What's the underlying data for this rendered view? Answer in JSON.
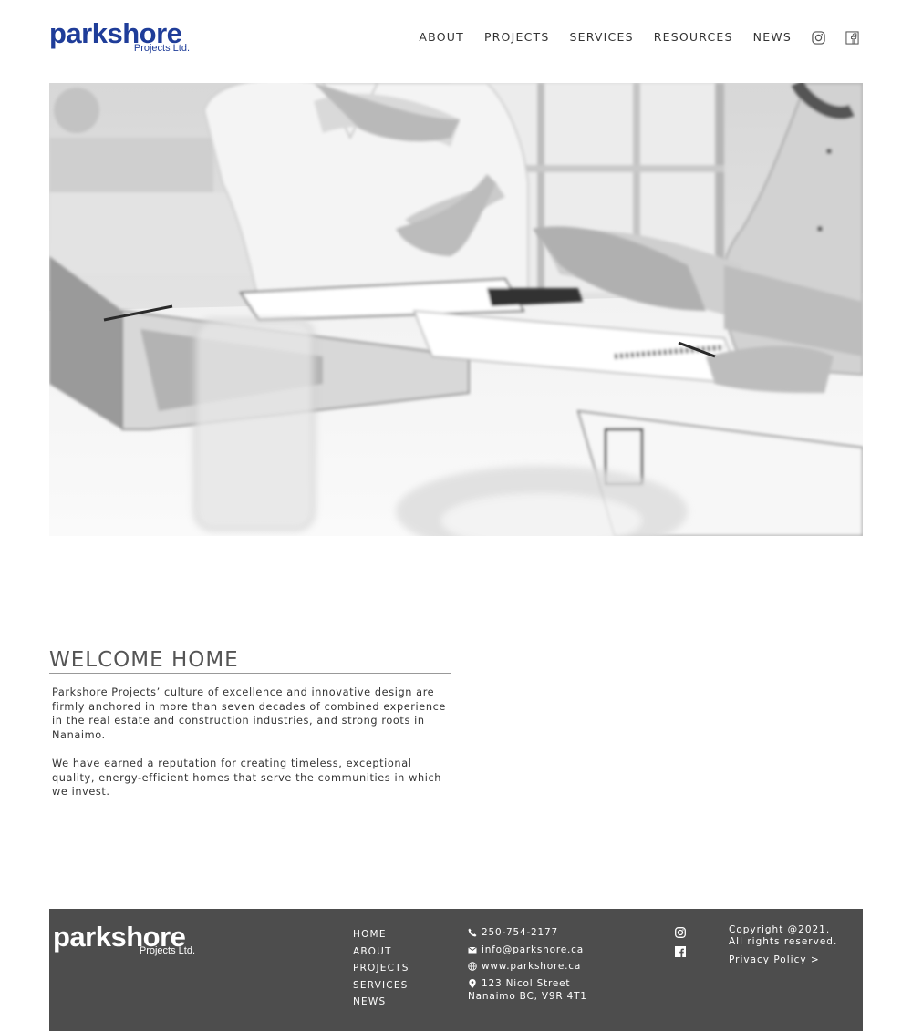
{
  "header": {
    "logo_word": "parkshore",
    "logo_sub": "Projects Ltd.",
    "nav": [
      "ABOUT",
      "PROJECTS",
      "SERVICES",
      "RESOURCES",
      "NEWS"
    ],
    "social_icons": [
      "instagram-icon",
      "facebook-icon"
    ]
  },
  "hero": {
    "alt_icon": "meeting-photo"
  },
  "welcome": {
    "title": "WELCOME HOME",
    "paragraphs": [
      "Parkshore Projects’ culture of excellence and innovative design are firmly anchored in more than seven decades of combined experience in the real estate and construction industries, and strong roots in Nanaimo.",
      "We have earned a reputation for creating timeless, exceptional quality, energy-efficient homes that serve the communities in which we invest."
    ]
  },
  "footer": {
    "logo_word": "parkshore",
    "logo_sub": "Projects Ltd.",
    "nav": [
      "HOME",
      "ABOUT",
      "PROJECTS",
      "SERVICES",
      "NEWS"
    ],
    "phone": "250-754-2177",
    "email": "info@parkshore.ca",
    "website": "www.parkshore.ca",
    "address_line1": "123 Nicol Street",
    "address_line2": "Nanaimo BC, V9R 4T1",
    "copyright_line1": "Copyright @2021.",
    "copyright_line2": "All rights reserved.",
    "privacy": "Privacy Policy >"
  },
  "colors": {
    "brand_blue": "#1f3d99",
    "footer_bg": "#4d4d4d",
    "text": "#333333"
  }
}
